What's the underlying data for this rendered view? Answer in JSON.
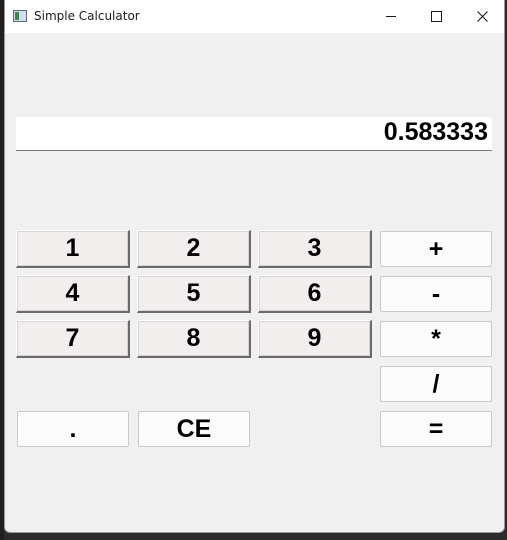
{
  "window": {
    "title": "Simple Calculator"
  },
  "display": {
    "value": "0.583333"
  },
  "buttons": {
    "b1": "1",
    "b2": "2",
    "b3": "3",
    "plus": "+",
    "b4": "4",
    "b5": "5",
    "b6": "6",
    "minus": "-",
    "b7": "7",
    "b8": "8",
    "b9": "9",
    "multiply": "*",
    "divide": "/",
    "dot": ".",
    "ce": "CE",
    "equals": "="
  },
  "colors": {
    "window_bg": "#f0f0f0",
    "number_button_bg": "#f3eeee",
    "operator_button_bg": "#fbfbfb"
  }
}
